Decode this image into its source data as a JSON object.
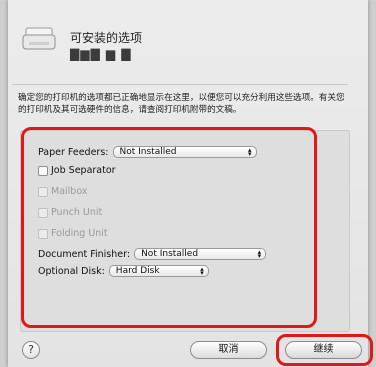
{
  "dialog": {
    "title": "可安装的选项",
    "subtitle": "▇▆▇ ▆ ▇",
    "description": "确定您的打印机的选项都已正确地显示在这里，以便您可以充分利用这些选项。有关您的打印机及其可选硬件的信息，请查阅打印机附带的文稿。"
  },
  "options": {
    "paper_feeders_label": "Paper Feeders:",
    "paper_feeders_value": "Not Installed",
    "job_separator_label": "Job Separator",
    "job_separator_checked": false,
    "mailbox_label": "Mailbox",
    "punch_unit_label": "Punch Unit",
    "folding_unit_label": "Folding Unit",
    "document_finisher_label": "Document Finisher:",
    "document_finisher_value": "Not Installed",
    "optional_disk_label": "Optional Disk:",
    "optional_disk_value": "Hard Disk"
  },
  "buttons": {
    "help": "?",
    "cancel": "取消",
    "continue": "继续"
  },
  "colors": {
    "highlight": "#e01818"
  },
  "icons": {
    "printer": "printer-icon",
    "popup_arrows": "updown-arrows-icon"
  }
}
